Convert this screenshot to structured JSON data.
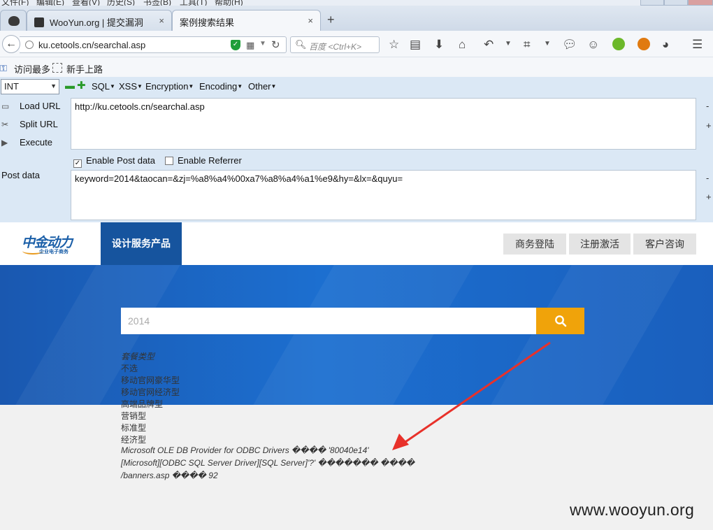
{
  "browser": {
    "menu": [
      "文件(F)",
      "编辑(E)",
      "查看(V)",
      "历史(S)",
      "书签(B)",
      "工具(T)",
      "帮助(H)"
    ],
    "tabs": [
      {
        "label": "WooYun.org | 提交漏洞",
        "close": "×"
      },
      {
        "label": "案例搜索结果",
        "close": "×"
      }
    ],
    "new_tab": "+",
    "url": "ku.cetools.cn/searchal.asp",
    "search_placeholder": "百度 <Ctrl+K>",
    "bookmarks": [
      {
        "label": "访问最多",
        "icon": "key-icon"
      },
      {
        "label": "新手上路",
        "icon": "dotted-box-icon"
      }
    ]
  },
  "hackbar": {
    "type_select": "INT",
    "menus": [
      "SQL",
      "XSS",
      "Encryption",
      "Encoding",
      "Other"
    ],
    "load_url": "Load URL",
    "split_url": "Split URL",
    "execute": "Execute",
    "url_value": "http://ku.cetools.cn/searchal.asp",
    "enable_post": "Enable Post data",
    "enable_post_checked": true,
    "enable_referrer": "Enable Referrer",
    "enable_referrer_checked": false,
    "post_label": "Post data",
    "post_value": "keyword=2014&taocan=&zj=%a8%a4%00xa7%a8%a4%a1%e9&hy=&lx=&quyu=",
    "minus": "-",
    "plus": "+"
  },
  "site": {
    "logo_text": "中金动力",
    "logo_sub": "企业电子商务",
    "nav_active": "设计服务产品",
    "header_buttons": [
      "商务登陆",
      "注册激活",
      "客户咨询"
    ],
    "search_value": "2014",
    "results": [
      {
        "text": "套餐类型",
        "italic": true
      },
      {
        "text": "不选",
        "italic": false
      },
      {
        "text": "移动官网豪华型",
        "italic": false
      },
      {
        "text": "移动官网经济型",
        "italic": false
      },
      {
        "text": "高端品牌型",
        "italic": false
      },
      {
        "text": "营销型",
        "italic": false
      },
      {
        "text": "标准型",
        "italic": false
      },
      {
        "text": "经济型",
        "italic": false
      },
      {
        "text": "Microsoft OLE DB Provider for ODBC Drivers ���� '80040e14'",
        "italic": true
      },
      {
        "text": "[Microsoft][ODBC SQL Server Driver][SQL Server]'?' ������� ����",
        "italic": true
      },
      {
        "text": "/banners.asp ���� 92",
        "italic": true
      }
    ],
    "watermark": "www.wooyun.org",
    "colors": {
      "brand_blue": "#16549e",
      "banner_blue": "#1c6fd0",
      "search_orange": "#f0a30a",
      "arrow_red": "#e8312a"
    }
  }
}
